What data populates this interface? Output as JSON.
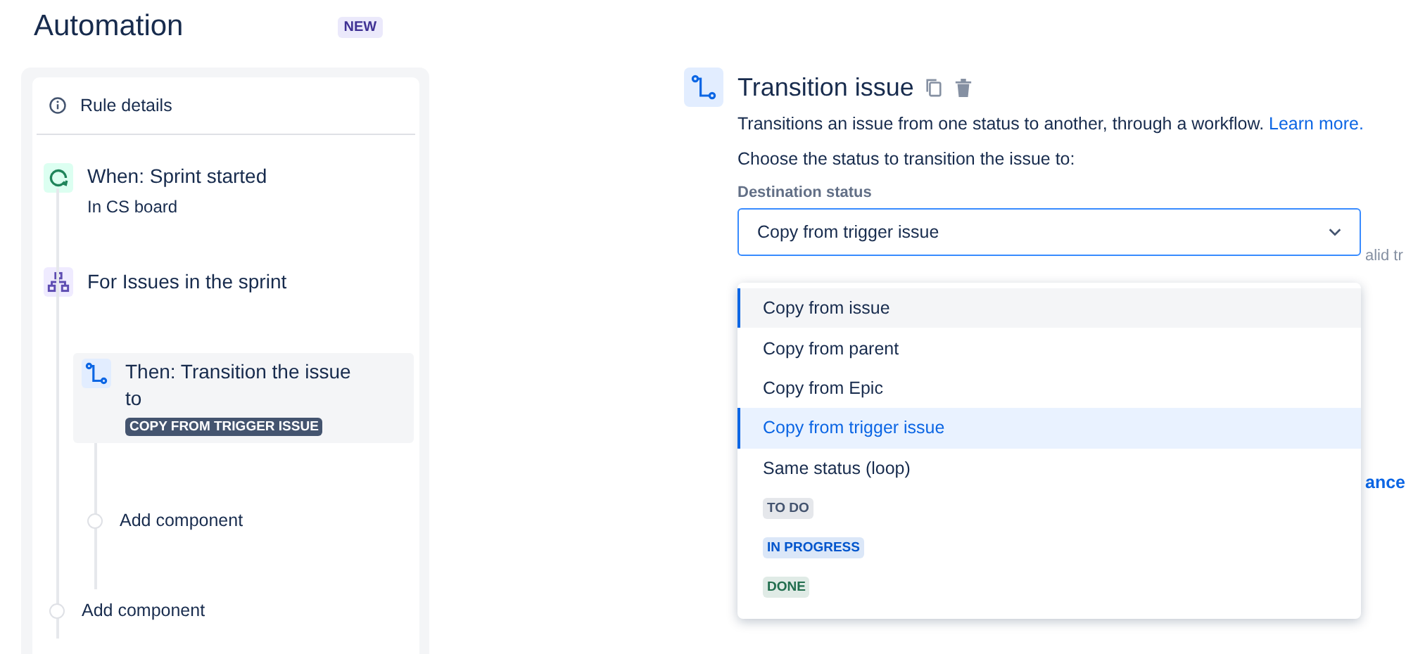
{
  "header": {
    "title": "Automation",
    "badge": "NEW"
  },
  "rule": {
    "details": "Rule details",
    "trigger": {
      "title": "When: Sprint started",
      "subtitle": "In CS board"
    },
    "branch": {
      "title": "For Issues in the sprint",
      "action": {
        "title": "Then: Transition the issue to",
        "tag": "COPY FROM TRIGGER ISSUE",
        "selected": true
      },
      "add": "Add component"
    },
    "add": "Add component"
  },
  "panel": {
    "title": "Transition issue",
    "description": "Transitions an issue from one status to another, through a workflow.",
    "link": "Learn more.",
    "prompt": "Choose the status to transition the issue to:",
    "field_label": "Destination status",
    "value": "Copy from trigger issue",
    "helper": "alid tr",
    "cancel": "ance",
    "options": [
      {
        "kind": "option",
        "label": "Copy from issue",
        "focused": true,
        "selected": false
      },
      {
        "kind": "option",
        "label": "Copy from parent",
        "focused": false,
        "selected": false
      },
      {
        "kind": "option",
        "label": "Copy from Epic",
        "focused": false,
        "selected": false
      },
      {
        "kind": "option",
        "label": "Copy from trigger issue",
        "focused": false,
        "selected": true
      },
      {
        "kind": "option",
        "label": "Same status (loop)",
        "focused": false,
        "selected": false
      },
      {
        "kind": "status",
        "label": "TO DO",
        "color": "#44546f",
        "focused": false,
        "selected": false
      },
      {
        "kind": "status",
        "label": "IN PROGRESS",
        "color": "#0055cc",
        "focused": false,
        "selected": false
      },
      {
        "kind": "status",
        "label": "DONE",
        "color": "#216e4e",
        "focused": false,
        "selected": false
      }
    ]
  }
}
